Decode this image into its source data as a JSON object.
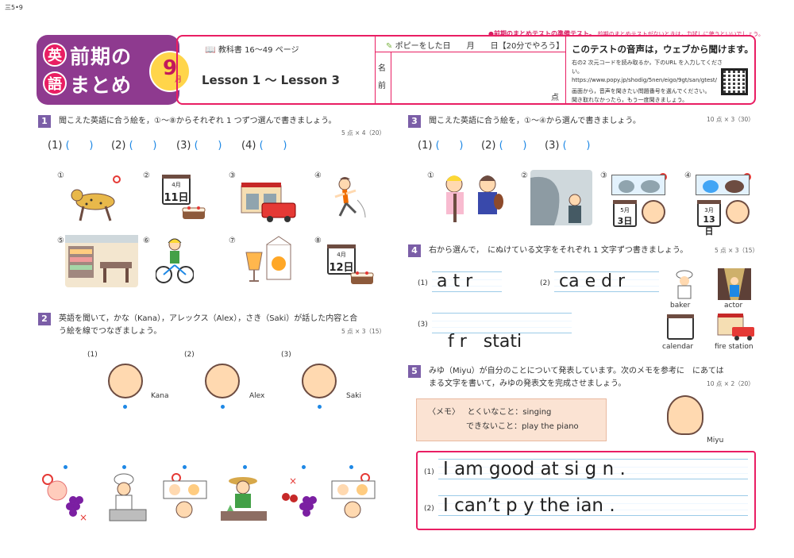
{
  "page_code": "三5•9",
  "top_note": {
    "main": "●前期のまとめテストの準備テスト。",
    "sub": "前期のまとめテストがないときは，力試しに使うといいでしょう。"
  },
  "title": {
    "kanji_top": "英",
    "kanji_bottom": "語",
    "line1": "前期の",
    "line2": "まとめ",
    "month_num": "9",
    "month_unit": "月"
  },
  "header": {
    "textbook": "教科書 16〜49 ページ",
    "lesson": "Lesson 1 〜 Lesson 3",
    "popy_date": "ポピーをした日　　月　　日【20分でやろう】",
    "name_label": "名前",
    "score_label": "点",
    "web_title": "このテストの音声は，ウェブから聞けます。",
    "web_desc1": "右の2 次元コードを読み取るか，下のURL を入力してください。",
    "web_url": "https://www.popy.jp/shodig/5nen/eigo/9gt/san/gtest/",
    "web_desc2": "画面から，音声を聞きたい問題番号を選んでください。",
    "web_desc3": "聞き取れなかったら，もう一度聞きましょう。"
  },
  "q1": {
    "num": "1",
    "text": "聞こえた英語に合う絵を，①〜⑧からそれぞれ 1 つずつ選んで書きましょう。",
    "points": "5 点 × 4（20）",
    "blanks": [
      "(1)",
      "(2)",
      "(3)",
      "(4)"
    ],
    "pics": [
      "①",
      "②",
      "③",
      "④",
      "⑤",
      "⑥",
      "⑦",
      "⑧"
    ],
    "cal2": {
      "month": "4月",
      "day": "11日"
    },
    "cal8": {
      "month": "4月",
      "day": "12日"
    }
  },
  "q2": {
    "num": "2",
    "text1": "英語を聞いて，かな（Kana），アレックス（Alex），さき（Saki）が話した内容と合",
    "text2": "う絵を線でつなぎましょう。",
    "points": "5 点 × 3（15）",
    "people": [
      {
        "num": "(1)",
        "name": "Kana"
      },
      {
        "num": "(2)",
        "name": "Alex"
      },
      {
        "num": "(3)",
        "name": "Saki"
      }
    ]
  },
  "q3": {
    "num": "3",
    "text": "聞こえた英語に合う絵を，①〜④から選んで書きましょう。",
    "points": "10 点 × 3（30）",
    "blanks": [
      "(1)",
      "(2)",
      "(3)"
    ],
    "pics": [
      "①",
      "②",
      "③",
      "④"
    ],
    "cal3": {
      "month": "5月",
      "day": "3日"
    },
    "cal4": {
      "month": "3月",
      "day": "13日"
    }
  },
  "q4": {
    "num": "4",
    "text": "右から選んで，　にぬけている文字をそれぞれ 1 文字ずつ書きましょう。",
    "points": "5 点 × 3（15）",
    "items": [
      {
        "num": "(1)",
        "text": "a t r"
      },
      {
        "num": "(2)",
        "text": "ca e d r"
      },
      {
        "num": "(3)",
        "text": "f r   stati"
      }
    ],
    "choices": [
      "baker",
      "actor",
      "calendar",
      "fire station"
    ]
  },
  "q5": {
    "num": "5",
    "text1": "みゆ（Miyu）が自分のことについて発表しています。次のメモを参考に　にあては",
    "text2": "まる文字を書いて，みゆの発表文を完成させましょう。",
    "points": "10 点 × 2（20）",
    "memo_label": "〈メモ〉",
    "memo_line1": "とくいなこと：singing",
    "memo_line2": "できないこと：play the piano",
    "person": "Miyu",
    "lines": [
      {
        "num": "(1)",
        "text": "I am good at si g n ."
      },
      {
        "num": "(2)",
        "text": "I can’t p y the ian ."
      }
    ]
  }
}
